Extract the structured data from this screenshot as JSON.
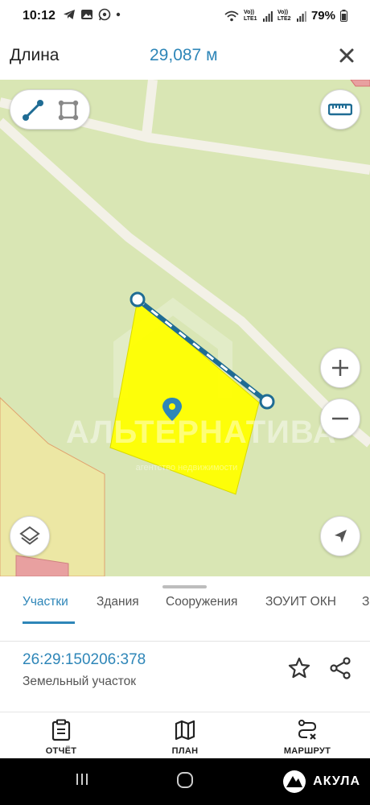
{
  "status_bar": {
    "time": "10:12",
    "battery": "79%",
    "sim1_label": "Vo)) LTE1",
    "sim2_label": "Vo)) LTE2"
  },
  "header": {
    "title": "Длина",
    "value": "29,087 м"
  },
  "map": {
    "watermark": "АЛЬТЕРНАТИВА",
    "watermark_sub": "агентство недвижимости",
    "parcel_color": "#ffff00",
    "measure_line_color": "#1f6c94",
    "icons": {
      "line_tool": "line-measure-icon",
      "area_tool": "area-measure-icon",
      "ruler": "ruler-icon",
      "zoom_in": "plus-icon",
      "zoom_out": "minus-icon",
      "layers": "layers-icon",
      "location": "navigation-arrow-icon",
      "marker": "map-pin-icon"
    }
  },
  "sheet": {
    "tabs": [
      {
        "label": "Участки",
        "active": true
      },
      {
        "label": "Здания",
        "active": false
      },
      {
        "label": "Сооружения",
        "active": false
      },
      {
        "label": "ЗОУИТ ОКН",
        "active": false
      },
      {
        "label": "З",
        "active": false
      }
    ],
    "parcel_number": "26:29:150206:378",
    "parcel_type": "Земельный участок"
  },
  "bottom_nav": {
    "items": [
      {
        "label": "ОТЧЁТ",
        "icon": "clipboard-icon"
      },
      {
        "label": "ПЛАН",
        "icon": "map-icon"
      },
      {
        "label": "МАРШРУТ",
        "icon": "route-icon"
      }
    ]
  },
  "system_nav": {
    "brand": "АКУЛА"
  },
  "colors": {
    "accent": "#2e86b8",
    "map_background": "#d9e6b4",
    "road": "#f3f1e7"
  }
}
